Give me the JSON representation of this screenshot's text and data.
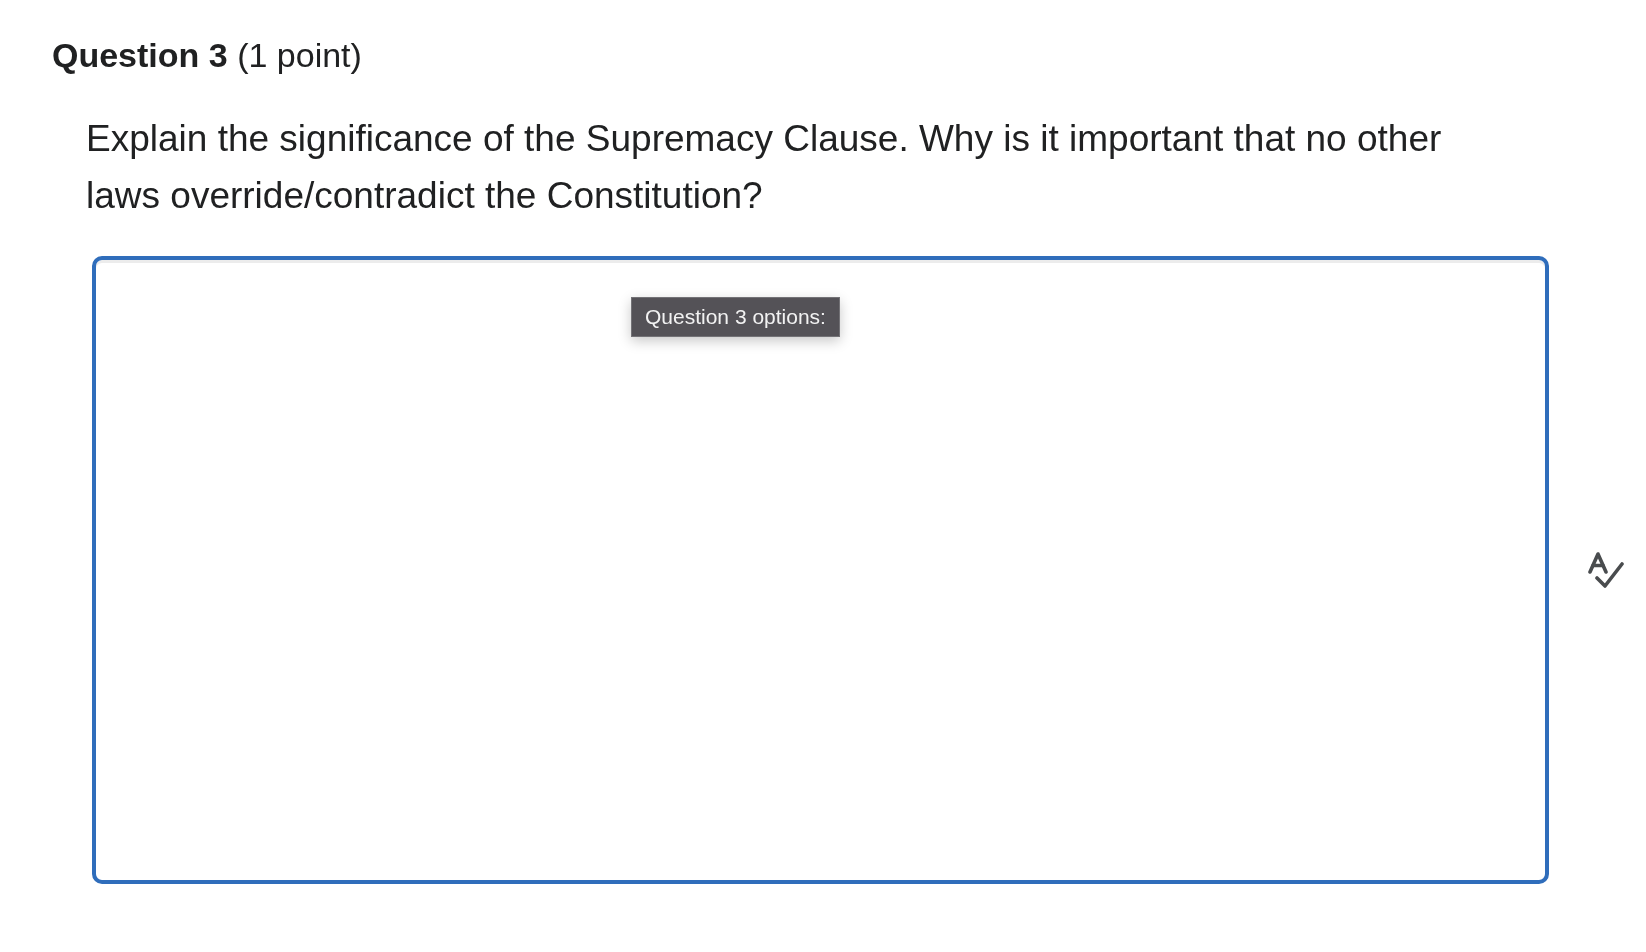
{
  "question": {
    "title": "**Question 3** (1 point)",
    "prompt": "Explain the significance of the Supremacy Clause. Why is it important that no other laws override/contradict the Constitution?"
  },
  "answer": {
    "tooltip": "Question 3 options:"
  }
}
